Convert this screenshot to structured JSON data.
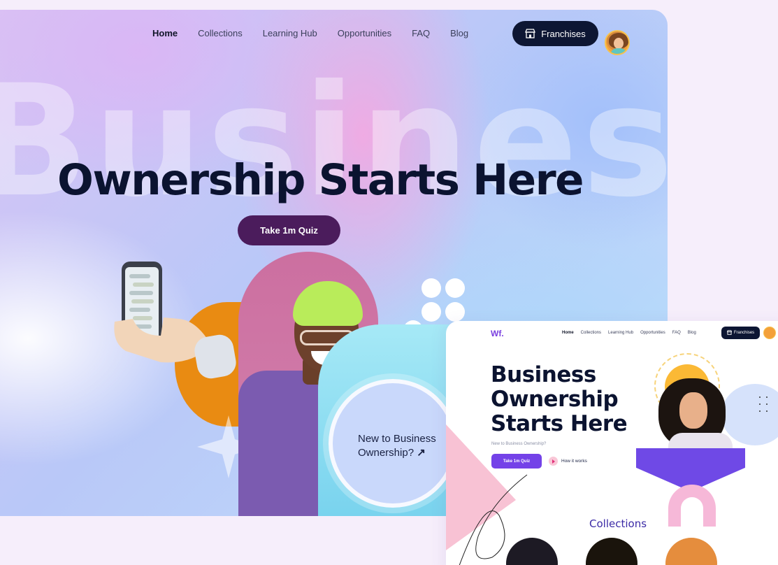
{
  "nav": {
    "links": [
      "Home",
      "Collections",
      "Learning Hub",
      "Opportunities",
      "FAQ",
      "Blog"
    ],
    "active": "Home",
    "cta_label": "Franchises"
  },
  "hero": {
    "background_word": "Business",
    "headline": "Ownership Starts Here",
    "cta_label": "Take 1m Quiz",
    "badge_text": "New to Business Ownership?",
    "badge_arrow": "↗"
  },
  "preview": {
    "logo": "Wf.",
    "nav_links": [
      "Home",
      "Collections",
      "Learning Hub",
      "Opportunities",
      "FAQ",
      "Blog"
    ],
    "cta_label": "Franchises",
    "headline_lines": [
      "Business",
      "Ownership",
      "Starts Here"
    ],
    "subtext": "New to Business Ownership?",
    "quiz_label": "Take 1m Quiz",
    "how_label": "How it works",
    "section_title": "Collections"
  },
  "colors": {
    "accent_dark": "#0d1633",
    "quiz_button": "#4b1c5c",
    "preview_accent": "#7442e8"
  }
}
